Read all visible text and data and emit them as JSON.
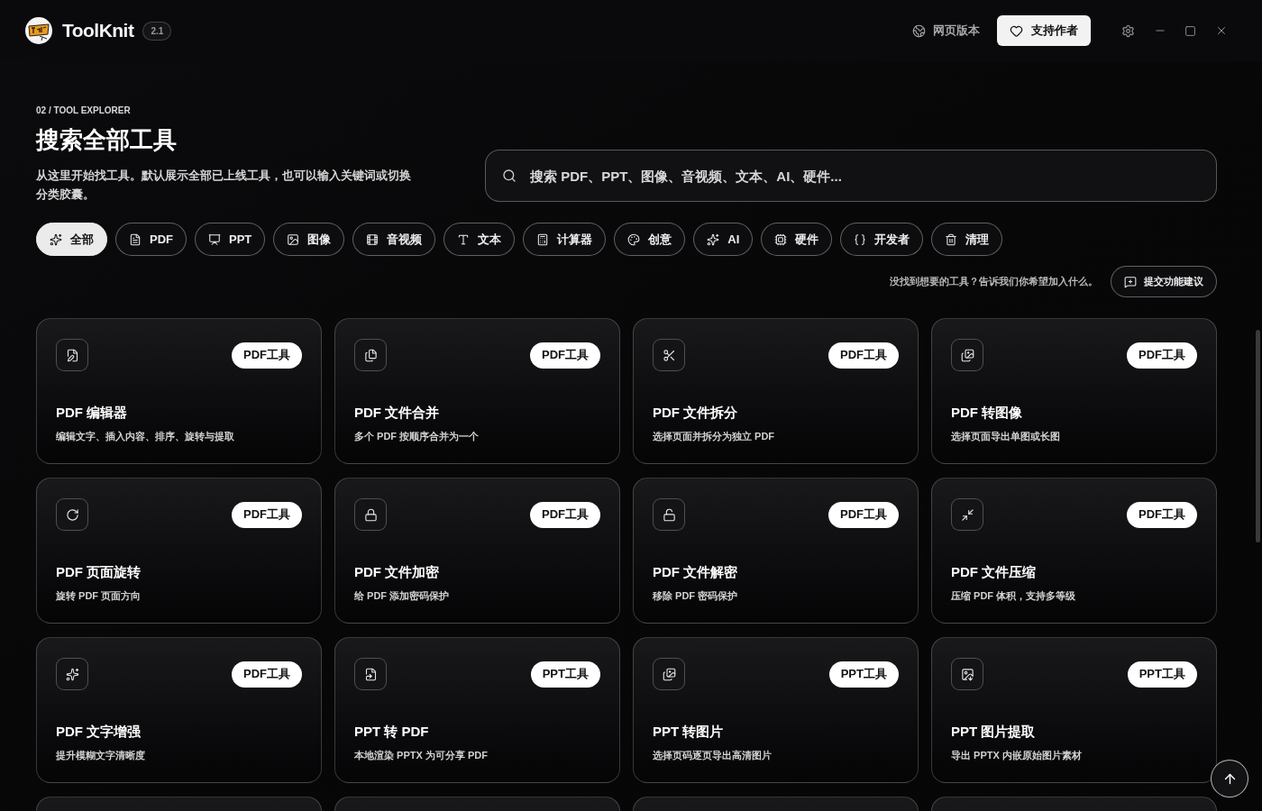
{
  "app": {
    "name": "ToolKnit",
    "version": "2.1"
  },
  "top_bar": {
    "web_version_link": "网页版本",
    "support_button": "支持作者"
  },
  "header": {
    "eyebrow": "02 / TOOL EXPLORER",
    "title": "搜索全部工具",
    "description": "从这里开始找工具。默认展示全部已上线工具，也可以输入关键词或切换分类胶囊。"
  },
  "search": {
    "placeholder": "搜索 PDF、PPT、图像、音视频、文本、AI、硬件..."
  },
  "categories": [
    {
      "label": "全部",
      "selected": true
    },
    {
      "label": "PDF",
      "selected": false
    },
    {
      "label": "PPT",
      "selected": false
    },
    {
      "label": "图像",
      "selected": false
    },
    {
      "label": "音视频",
      "selected": false
    },
    {
      "label": "文本",
      "selected": false
    },
    {
      "label": "计算器",
      "selected": false
    },
    {
      "label": "创意",
      "selected": false
    },
    {
      "label": "AI",
      "selected": false
    },
    {
      "label": "硬件",
      "selected": false
    },
    {
      "label": "开发者",
      "selected": false
    },
    {
      "label": "清理",
      "selected": false
    }
  ],
  "suggestion": {
    "text": "没找到想要的工具？告诉我们你希望加入什么。",
    "button": "提交功能建议"
  },
  "tools": [
    {
      "title": "PDF 编辑器",
      "description": "编辑文字、插入内容、排序、旋转与提取",
      "tag": "PDF工具"
    },
    {
      "title": "PDF 文件合并",
      "description": "多个 PDF 按顺序合并为一个",
      "tag": "PDF工具"
    },
    {
      "title": "PDF 文件拆分",
      "description": "选择页面并拆分为独立 PDF",
      "tag": "PDF工具"
    },
    {
      "title": "PDF 转图像",
      "description": "选择页面导出单图或长图",
      "tag": "PDF工具"
    },
    {
      "title": "PDF 页面旋转",
      "description": "旋转 PDF 页面方向",
      "tag": "PDF工具"
    },
    {
      "title": "PDF 文件加密",
      "description": "给 PDF 添加密码保护",
      "tag": "PDF工具"
    },
    {
      "title": "PDF 文件解密",
      "description": "移除 PDF 密码保护",
      "tag": "PDF工具"
    },
    {
      "title": "PDF 文件压缩",
      "description": "压缩 PDF 体积，支持多等级",
      "tag": "PDF工具"
    },
    {
      "title": "PDF 文字增强",
      "description": "提升模糊文字清晰度",
      "tag": "PDF工具"
    },
    {
      "title": "PPT 转 PDF",
      "description": "本地渲染 PPTX 为可分享 PDF",
      "tag": "PPT工具"
    },
    {
      "title": "PPT 转图片",
      "description": "选择页码逐页导出高清图片",
      "tag": "PPT工具"
    },
    {
      "title": "PPT 图片提取",
      "description": "导出 PPTX 内嵌原始图片素材",
      "tag": "PPT工具"
    }
  ]
}
